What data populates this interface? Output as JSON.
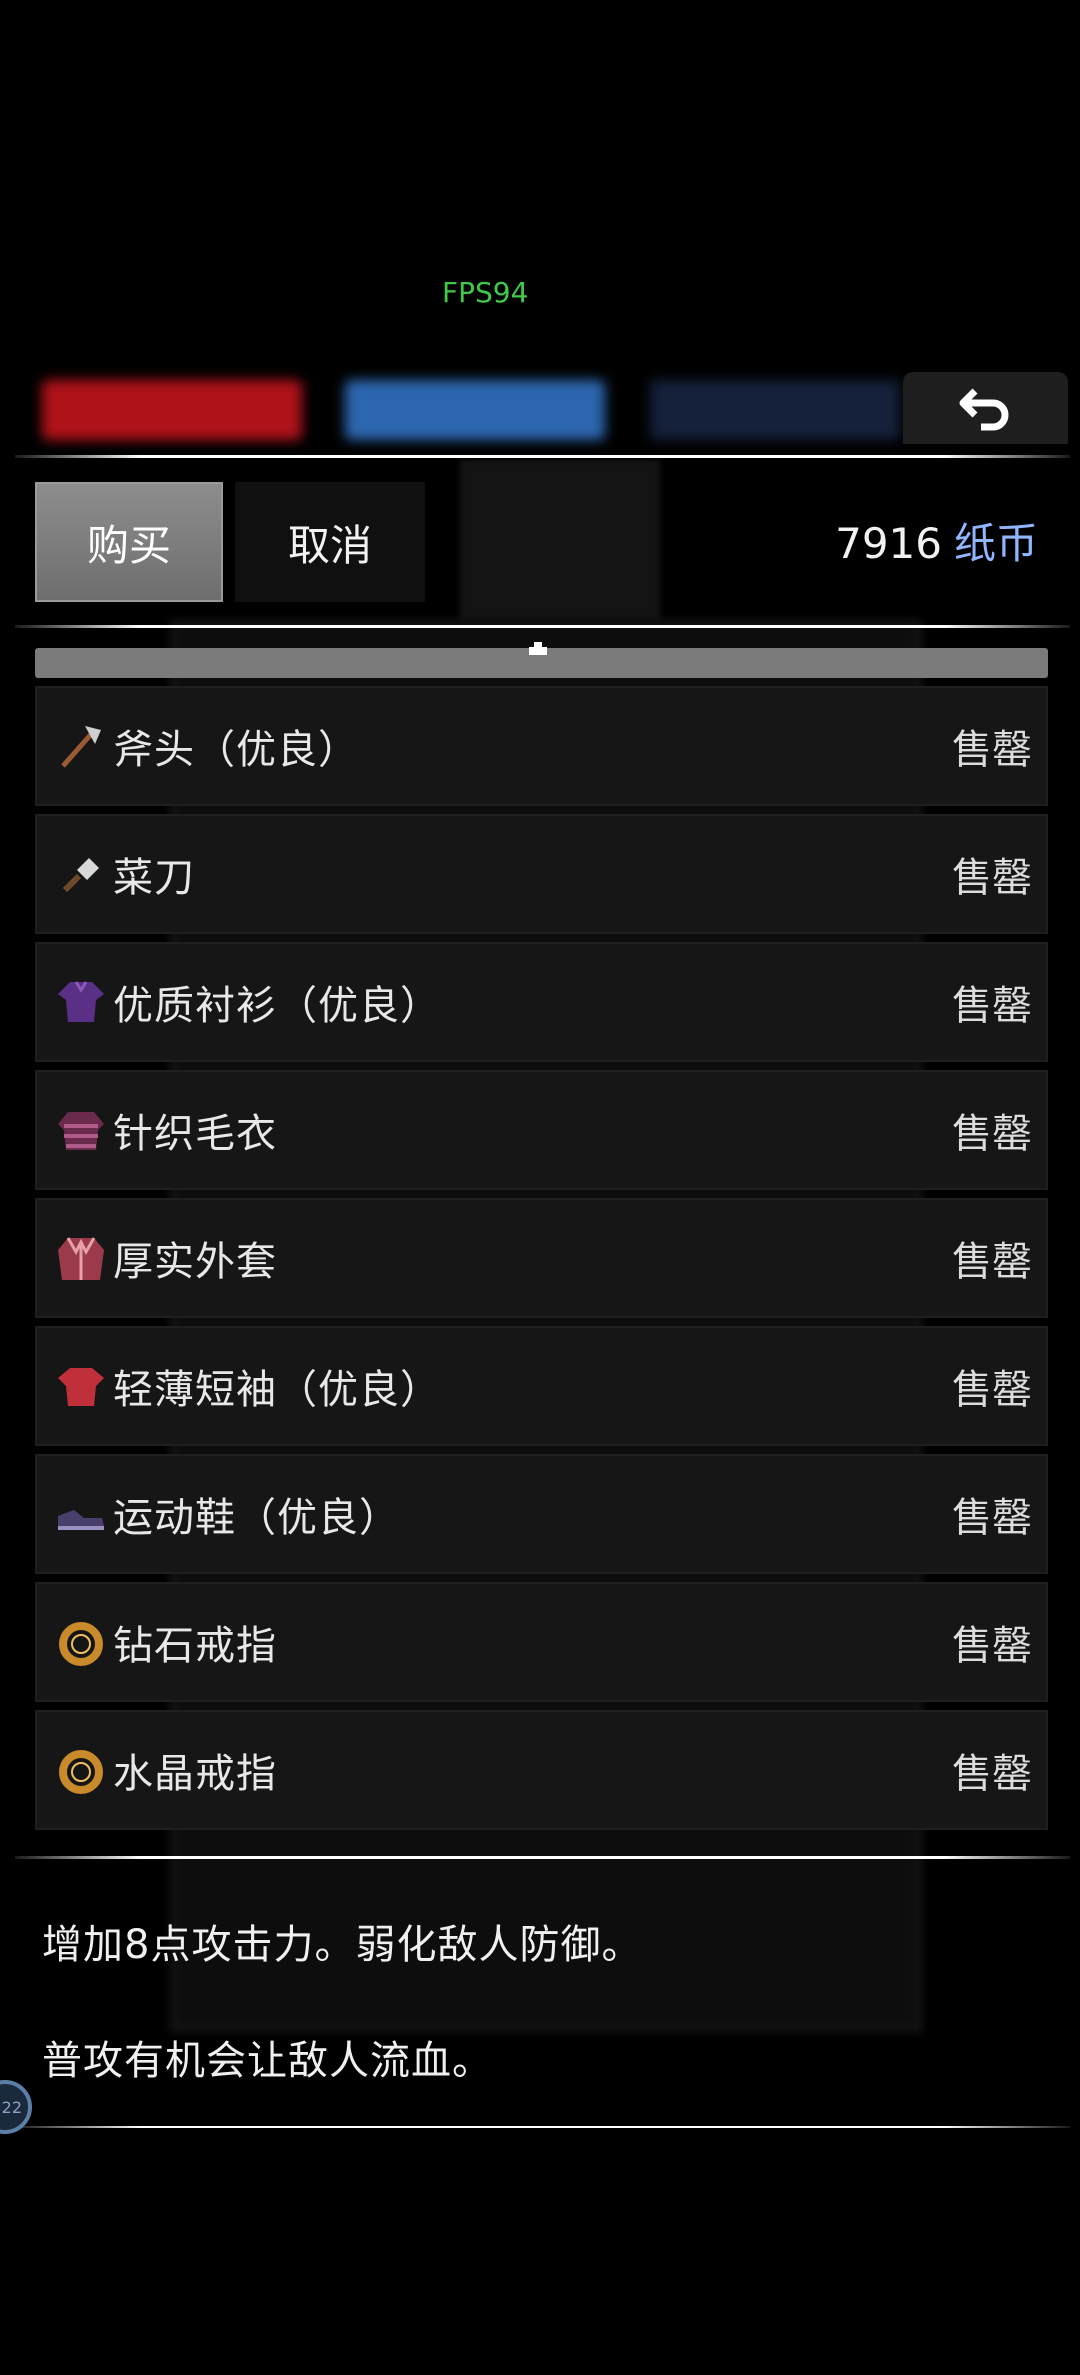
{
  "hud": {
    "fps": "FPS94",
    "badge": "22"
  },
  "toolbar": {
    "buy_label": "购买",
    "cancel_label": "取消"
  },
  "currency": {
    "amount": "7916",
    "unit": "纸币"
  },
  "items": [
    {
      "name": "斧头（优良）",
      "status": "售罄",
      "icon": "axe-icon"
    },
    {
      "name": "菜刀",
      "status": "售罄",
      "icon": "cleaver-icon"
    },
    {
      "name": "优质衬衫（优良）",
      "status": "售罄",
      "icon": "shirt-icon"
    },
    {
      "name": "针织毛衣",
      "status": "售罄",
      "icon": "sweater-icon"
    },
    {
      "name": "厚实外套",
      "status": "售罄",
      "icon": "jacket-icon"
    },
    {
      "name": "轻薄短袖（优良）",
      "status": "售罄",
      "icon": "tshirt-icon"
    },
    {
      "name": "运动鞋（优良）",
      "status": "售罄",
      "icon": "sneakers-icon"
    },
    {
      "name": "钻石戒指",
      "status": "售罄",
      "icon": "ring-icon"
    },
    {
      "name": "水晶戒指",
      "status": "售罄",
      "icon": "ring-icon"
    }
  ],
  "description": {
    "line1": "增加8点攻击力。弱化敌人防御。",
    "line2": "普攻有机会让敌人流血。"
  },
  "colors": {
    "fps": "#3fc94a",
    "currency_unit": "#8fb6ff",
    "buy_button": "#7e7e7e"
  }
}
